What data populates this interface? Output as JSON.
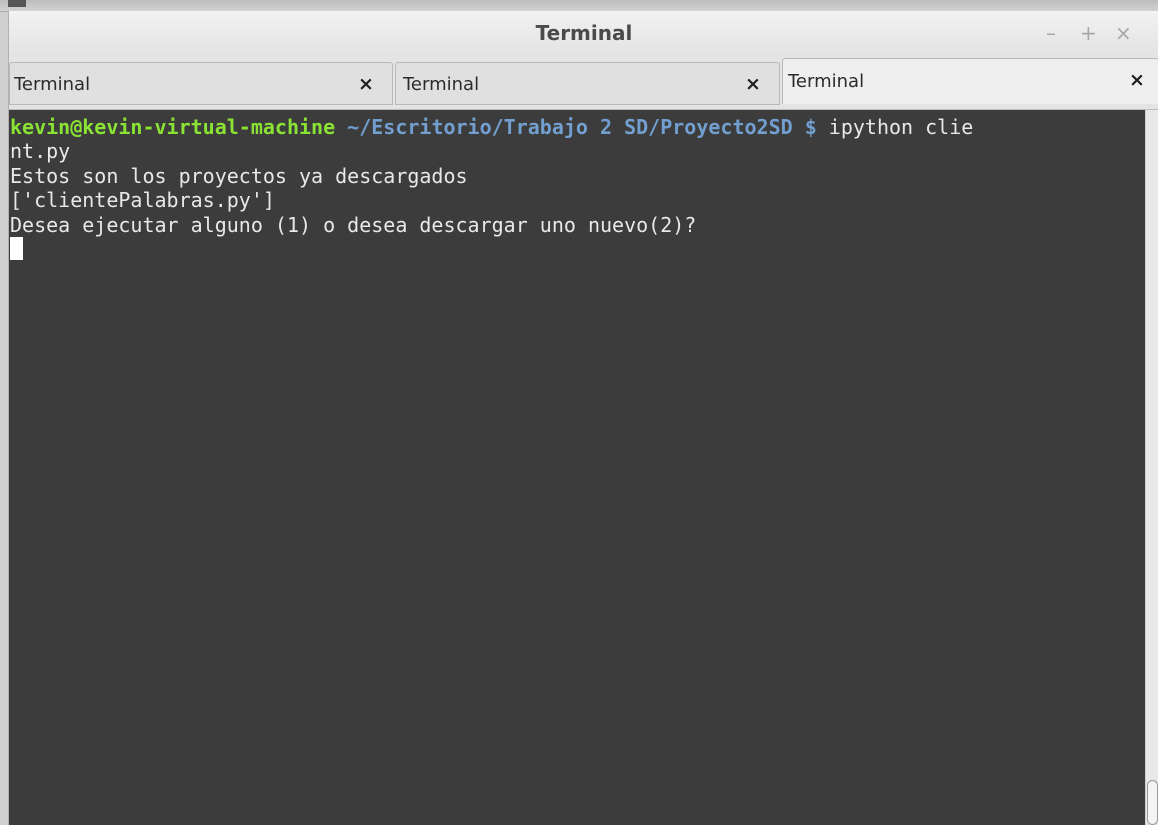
{
  "window": {
    "title": "Terminal",
    "controls": {
      "minimize": "–",
      "maximize": "+",
      "close": "×"
    }
  },
  "tabs": [
    {
      "label": "Terminal",
      "close": "×",
      "active": false
    },
    {
      "label": "Terminal",
      "close": "×",
      "active": false
    },
    {
      "label": "Terminal",
      "close": "×",
      "active": true
    }
  ],
  "terminal": {
    "prompt_user": "kevin@kevin-virtual-machine",
    "prompt_path": " ~/Escritorio/Trabajo 2 SD/Proyecto2SD $",
    "command_part1": " ipython clie",
    "command_part2": "nt.py",
    "output": [
      "Estos son los proyectos ya descargados",
      "['clientePalabras.py']",
      "Desea ejecutar alguno (1) o desea descargar uno nuevo(2)?"
    ]
  },
  "colors": {
    "terminal_bg": "#3c3c3c",
    "prompt_user": "#8ae234",
    "prompt_path": "#729fcf",
    "text": "#e8e8e8"
  }
}
